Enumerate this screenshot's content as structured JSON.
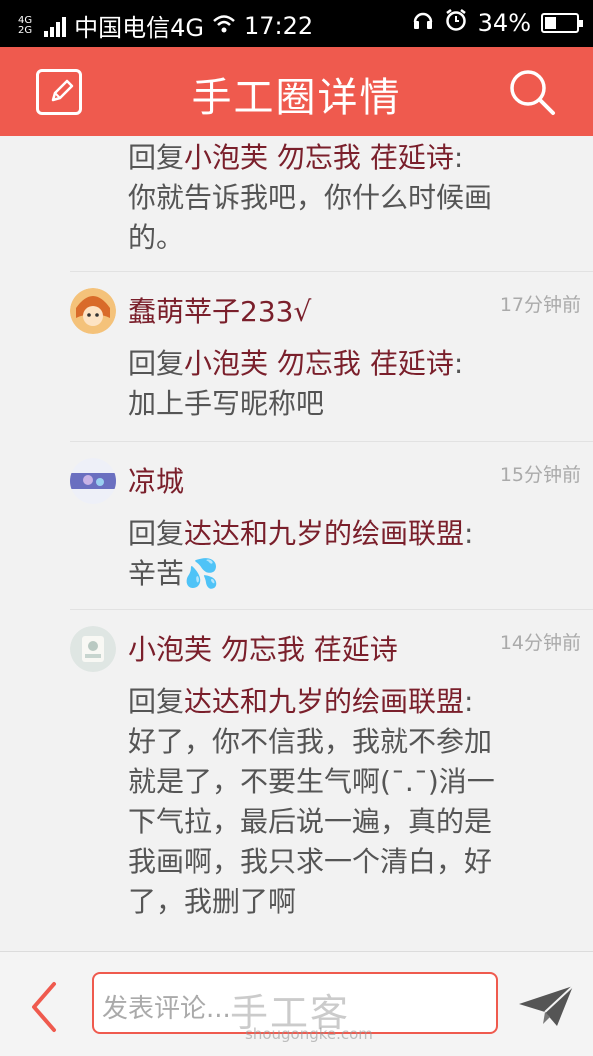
{
  "status_bar": {
    "network_type": "4G\n2G",
    "carrier": "中国电信4G",
    "time": "17:22",
    "battery": "34%"
  },
  "header": {
    "title": "手工圈详情",
    "left_icon": "edit-icon",
    "right_icon": "search-icon"
  },
  "comments": [
    {
      "reply_prefix": "回复",
      "reply_to": "小泡芙  勿忘我 荏延诗",
      "text": ": 你就告诉我吧，你什么时候画的。"
    },
    {
      "username": "蠢萌苹子233√",
      "time": "17分钟前",
      "reply_prefix": "回复",
      "reply_to": "小泡芙  勿忘我 荏延诗",
      "text": ": 加上手写昵称吧"
    },
    {
      "username": "凉城",
      "time": "15分钟前",
      "reply_prefix": "回复",
      "reply_to": "达达和九岁的绘画联盟",
      "text": ": 辛苦💦"
    },
    {
      "username": "小泡芙  勿忘我 荏延诗",
      "time": "14分钟前",
      "reply_prefix": "回复",
      "reply_to": "达达和九岁的绘画联盟",
      "text": ": 好了，你不信我，我就不参加就是了，不要生气啊(ˉ.ˉ)消一下气拉，最后说一遍，真的是我画啊，我只求一个清白，好了，我删了啊"
    }
  ],
  "bottom_bar": {
    "placeholder": "发表评论...",
    "back_icon": "chevron-left-icon",
    "send_icon": "send-icon"
  },
  "watermark": {
    "brand": "手工客",
    "url": "shougongke.com"
  },
  "colors": {
    "accent": "#ef5a4e",
    "username": "#7a1f2b"
  }
}
